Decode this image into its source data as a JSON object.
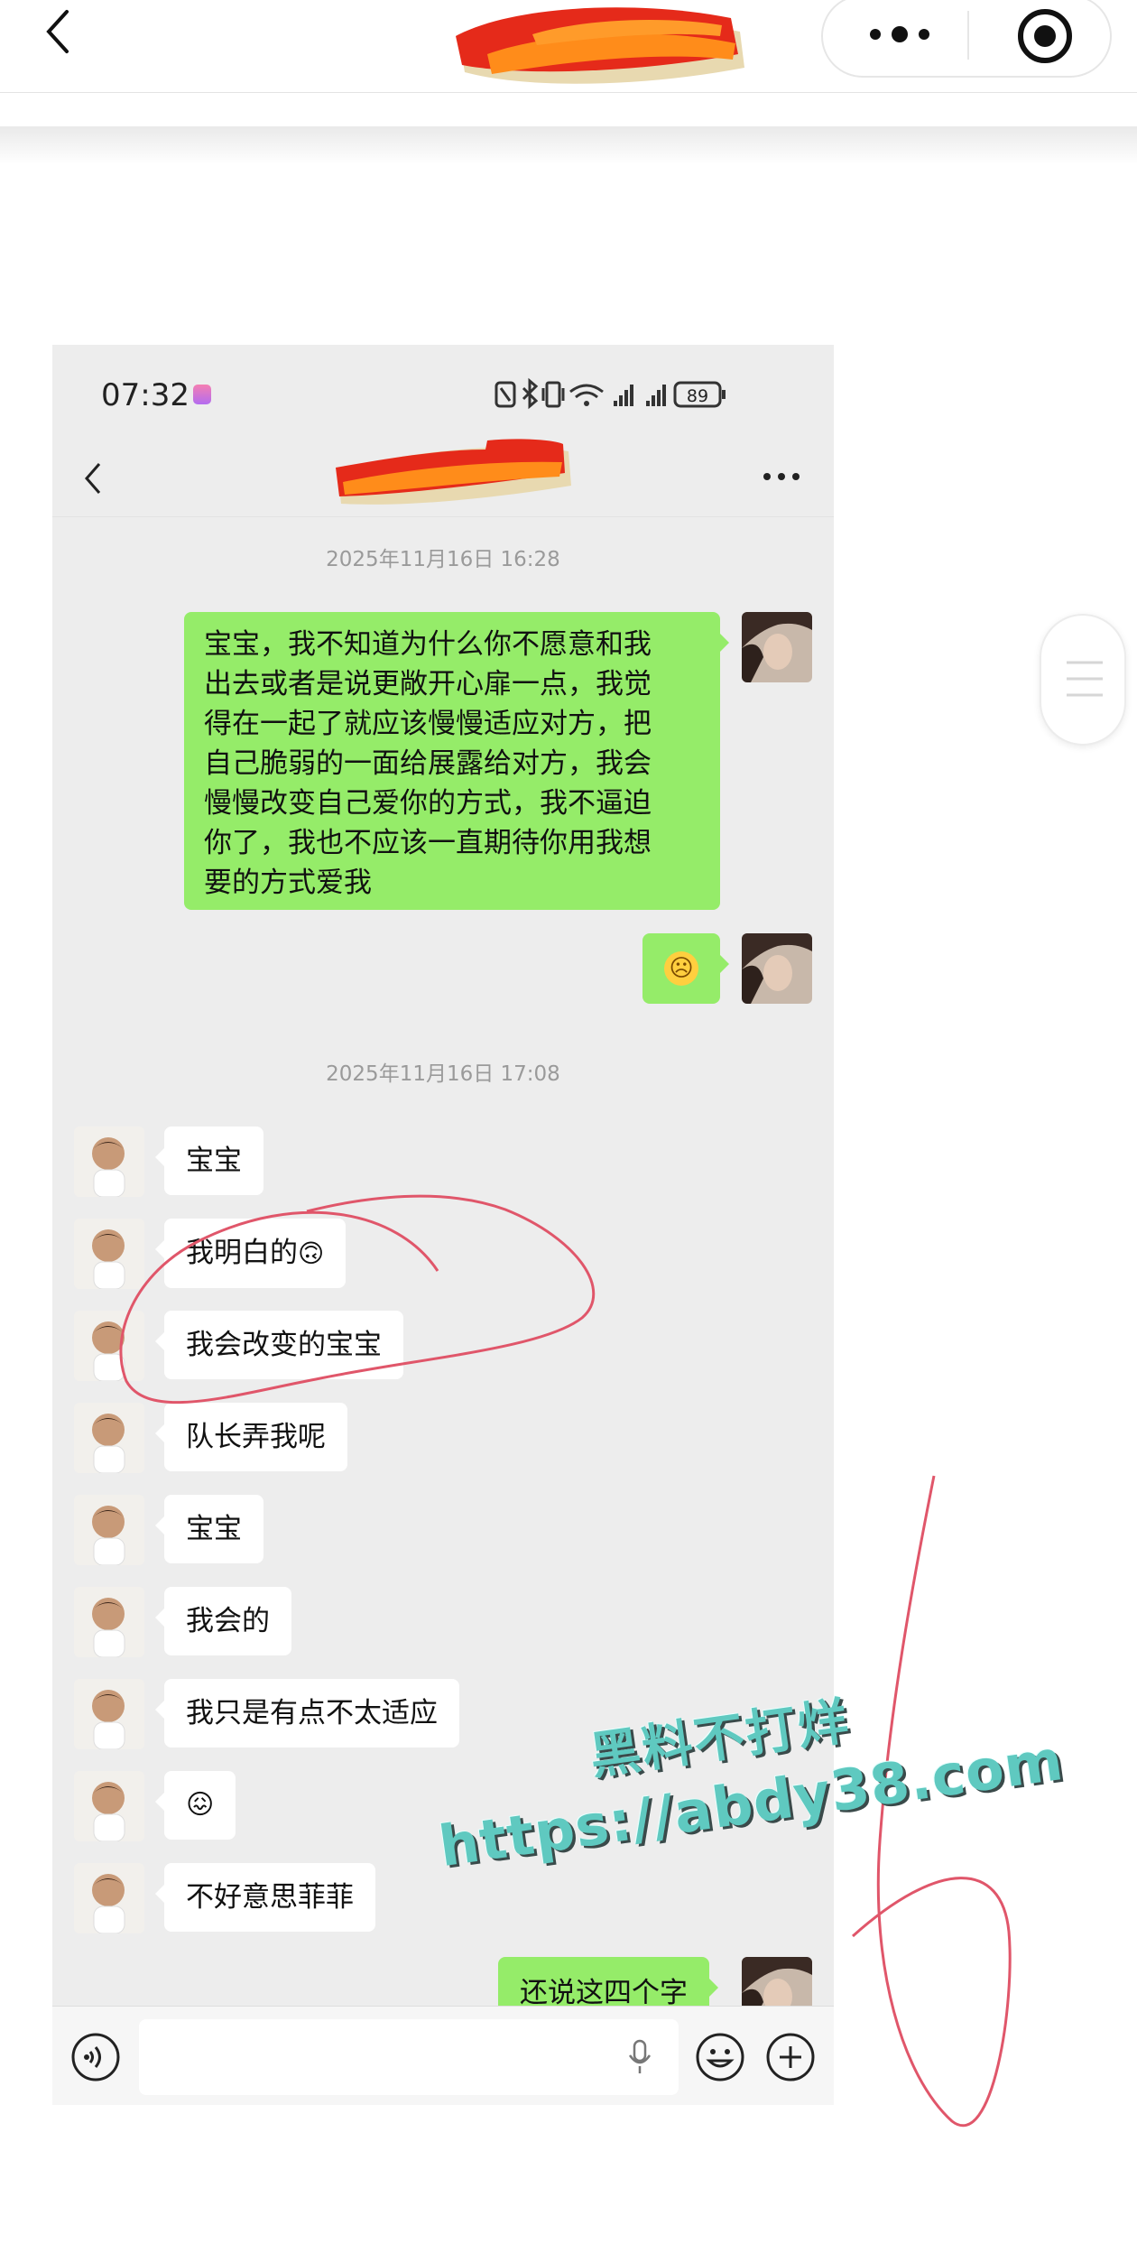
{
  "outer": {
    "title_hidden": "redacted-scribble",
    "back_icon": "chevron-left-icon",
    "more_icon": "more-dots-icon",
    "target_icon": "record-target-icon"
  },
  "phone": {
    "status": {
      "time": "07:32",
      "battery": "89"
    },
    "chat_title": "redacted-scribble",
    "timestamps": [
      "2025年11月16日 16:28",
      "2025年11月16日 17:08"
    ],
    "messages": [
      {
        "side": "sent",
        "text": "宝宝，我不知道为什么你不愿意和我\n出去或者是说更敞开心扉一点，我觉\n得在一起了就应该慢慢适应对方，把\n自己脆弱的一面给展露给对方，我会\n慢慢改变自己爱你的方式，我不逼迫\n你了，我也不应该一直期待你用我想\n要的方式爱我"
      },
      {
        "side": "sent",
        "text": "☹"
      },
      {
        "side": "recv",
        "text": "宝宝"
      },
      {
        "side": "recv",
        "text": "我明白的",
        "emoji": "🙃"
      },
      {
        "side": "recv",
        "text": "我会改变的宝宝"
      },
      {
        "side": "recv",
        "text": "队长弄我呢"
      },
      {
        "side": "recv",
        "text": "宝宝"
      },
      {
        "side": "recv",
        "text": "我会的"
      },
      {
        "side": "recv",
        "text": "我只是有点不太适应"
      },
      {
        "side": "recv",
        "text": "😖"
      },
      {
        "side": "recv",
        "text": "不好意思菲菲"
      },
      {
        "side": "sent",
        "text": "还说这四个字"
      }
    ]
  },
  "watermark": {
    "line1": "黑料不打烊",
    "line2": "https://abdy38.com"
  },
  "colors": {
    "sent_bubble": "#95ec69",
    "recv_bubble": "#ffffff",
    "chat_bg": "#ededed",
    "annotation": "#e0566a"
  }
}
